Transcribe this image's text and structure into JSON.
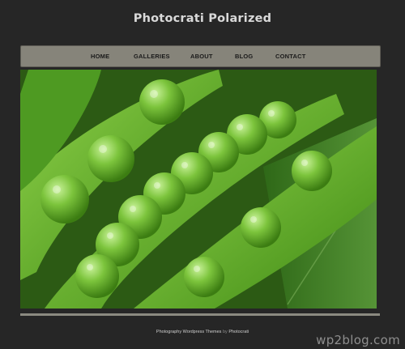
{
  "site": {
    "title": "Photocrati Polarized"
  },
  "nav": {
    "items": [
      {
        "label": "HOME"
      },
      {
        "label": "GALLERIES"
      },
      {
        "label": "ABOUT"
      },
      {
        "label": "BLOG"
      },
      {
        "label": "CONTACT"
      }
    ]
  },
  "footer": {
    "text_left": "Photography Wordpress Themes",
    "text_by": "by",
    "text_right": "Photocrati"
  },
  "watermark": {
    "text": "wp2blog.com"
  }
}
